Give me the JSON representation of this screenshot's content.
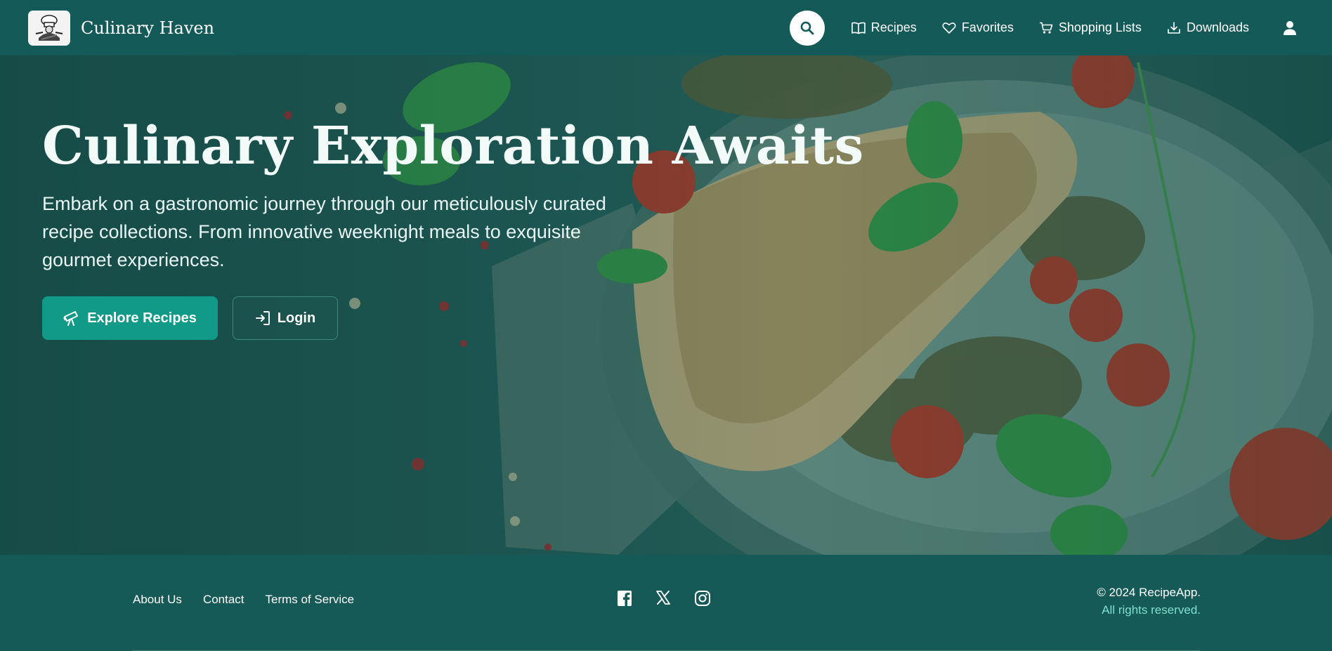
{
  "header": {
    "brand": "Culinary Haven",
    "search_icon": "search-icon",
    "nav": [
      {
        "label": "Recipes",
        "icon": "book-icon"
      },
      {
        "label": "Favorites",
        "icon": "heart-icon"
      },
      {
        "label": "Shopping Lists",
        "icon": "cart-icon"
      },
      {
        "label": "Downloads",
        "icon": "download-icon"
      }
    ],
    "user_icon": "user-icon"
  },
  "hero": {
    "title": "Culinary Exploration Awaits",
    "subtitle": "Embark on a gastronomic journey through our meticulously curated recipe collections. From innovative weeknight meals to exquisite gourmet experiences.",
    "primary_button": "Explore Recipes",
    "secondary_button": "Login"
  },
  "footer": {
    "links": [
      "About Us",
      "Contact",
      "Terms of Service"
    ],
    "social": [
      "facebook-icon",
      "x-icon",
      "instagram-icon"
    ],
    "copyright": "© 2024 RecipeApp.",
    "rights": "All rights reserved."
  },
  "colors": {
    "header_bg": "#145a58",
    "primary_button": "#129a88",
    "footer_bg": "#155a57",
    "accent_text": "#7ee0cc"
  }
}
